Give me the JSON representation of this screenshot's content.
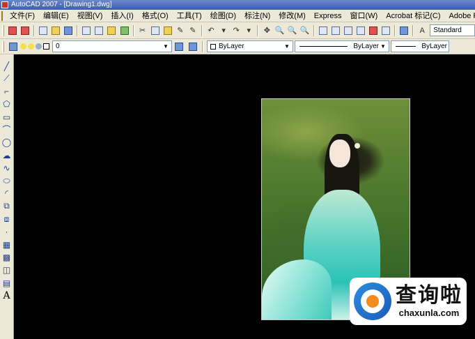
{
  "window": {
    "title": "AutoCAD 2007 - [Drawing1.dwg]"
  },
  "menubar": {
    "items": [
      "文件(F)",
      "编辑(E)",
      "视图(V)",
      "插入(I)",
      "格式(O)",
      "工具(T)",
      "绘图(D)",
      "标注(N)",
      "修改(M)",
      "Express",
      "窗口(W)",
      "Acrobat 标记(C)",
      "Adobe PDF(B)"
    ]
  },
  "toolbar": {
    "text_style": "Standard"
  },
  "properties": {
    "layer": "0",
    "color": "ByLayer",
    "linetype": "ByLayer",
    "lineweight": "ByLayer"
  },
  "left_toolbar": {
    "text_tool": "A"
  },
  "watermark": {
    "name_cn": "查询啦",
    "domain": "chaxunla.com"
  }
}
